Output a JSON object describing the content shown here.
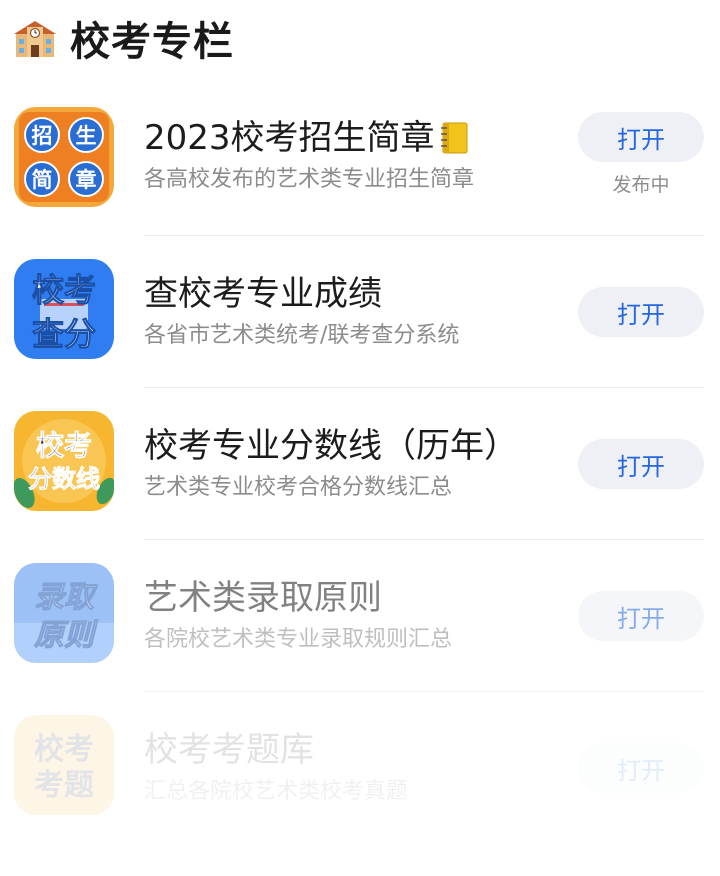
{
  "header": {
    "title": "校考专栏",
    "icon": "school-building-icon"
  },
  "items": [
    {
      "title": "2023校考招生简章",
      "title_icon": "notebook-icon",
      "subtitle": "各高校发布的艺术类专业招生简章",
      "button": "打开",
      "status": "发布中",
      "icon_chars": [
        "招",
        "生",
        "简",
        "章"
      ],
      "colors": {
        "bg": "#f08a24",
        "tile": "#2c6fd6"
      }
    },
    {
      "title": "查校考专业成绩",
      "subtitle": "各省市艺术类统考/联考查分系统",
      "button": "打开",
      "icon_chars": [
        "校考",
        "查分"
      ],
      "colors": {
        "bg": "#2f7df0"
      }
    },
    {
      "title": "校考专业分数线（历年）",
      "subtitle": "艺术类专业校考合格分数线汇总",
      "button": "打开",
      "icon_chars": [
        "校考",
        "分数线"
      ],
      "colors": {
        "bg": "#f5b52e"
      }
    },
    {
      "title": "艺术类录取原则",
      "subtitle": "各院校艺术类专业录取规则汇总",
      "button": "打开",
      "icon_chars": [
        "录取",
        "原则"
      ],
      "colors": {
        "bg": "#4a8ff0"
      }
    },
    {
      "title": "校考考题库",
      "subtitle": "汇总各院校艺术类校考真题",
      "button": "打开",
      "icon_chars": [
        "校考",
        "考题"
      ],
      "colors": {
        "bg": "#f5b52e"
      }
    }
  ]
}
